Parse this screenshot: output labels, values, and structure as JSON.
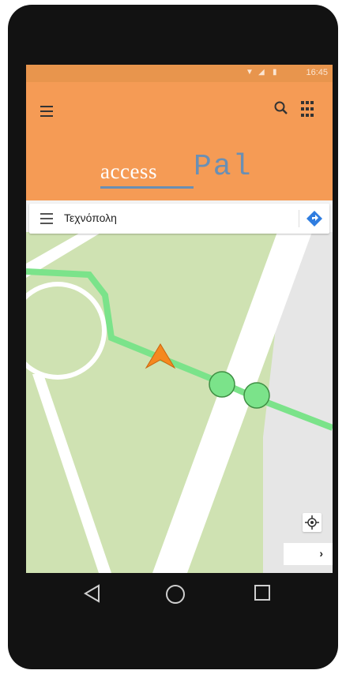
{
  "status_bar": {
    "time": "16:45"
  },
  "app_bar": {
    "menu_icon": "hamburger-menu-icon",
    "search_icon": "search-icon",
    "apps_icon": "grid-apps-icon",
    "background_color": "#f59b55"
  },
  "logo": {
    "part1": "access",
    "part2": "Pal"
  },
  "search": {
    "query": "Τεχνόπολη"
  },
  "map": {
    "route_color": "#7be38a",
    "park_color": "#cfe2b2",
    "road_color": "#ffffff",
    "position_marker": "orange-arrow",
    "waypoints": 2
  },
  "controls": {
    "recenter_icon": "my-location-icon",
    "next_label": "›"
  },
  "nav_bar": {
    "back_icon": "back-triangle-icon",
    "home_icon": "home-circle-icon",
    "recents_icon": "recents-square-icon"
  }
}
